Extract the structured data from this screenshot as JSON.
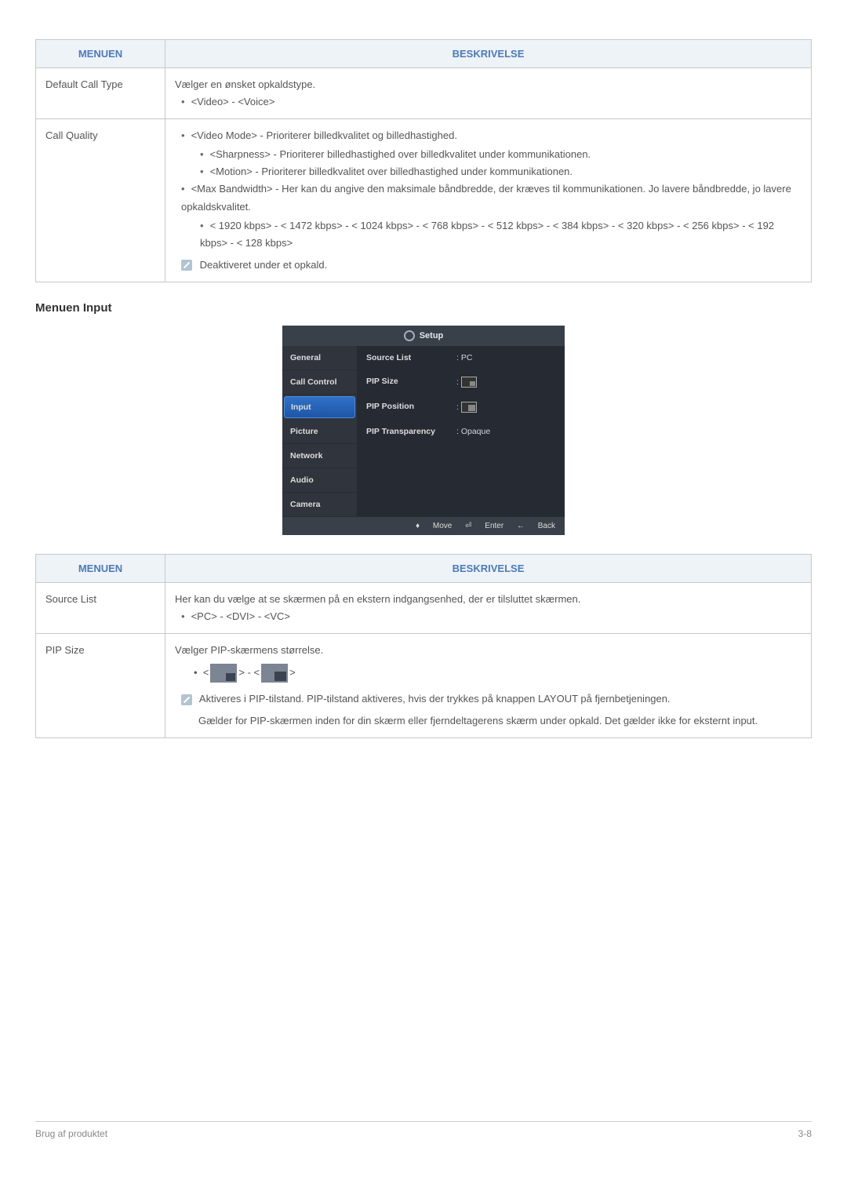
{
  "table1": {
    "th_menu": "MENUEN",
    "th_desc": "BESKRIVELSE",
    "row1": {
      "menu": "Default Call Type",
      "line1": "Vælger en ønsket opkaldstype.",
      "bullet1": "<Video> - <Voice>"
    },
    "row2": {
      "menu": "Call Quality",
      "b1": "<Video Mode> - Prioriterer billedkvalitet og billedhastighed.",
      "b1a": "<Sharpness> - Prioriterer billedhastighed over billedkvalitet under kommunikationen.",
      "b1b": "<Motion> - Prioriterer billedkvalitet over billedhastighed under kommunikationen.",
      "b2": "<Max Bandwidth> - Her kan du angive den maksimale båndbredde, der kræves til kommunikationen. Jo lavere båndbredde, jo lavere opkaldskvalitet.",
      "b2a": "< 1920 kbps> - < 1472 kbps> - < 1024 kbps> - < 768 kbps> - < 512 kbps> - < 384 kbps> - < 320 kbps> - < 256 kbps> - < 192 kbps> - < 128 kbps>",
      "note": "Deaktiveret under et opkald."
    }
  },
  "section_title": "Menuen Input",
  "osd": {
    "title": "Setup",
    "left": [
      "General",
      "Call Control",
      "Input",
      "Picture",
      "Network",
      "Audio",
      "Camera"
    ],
    "active_index": 2,
    "rows": [
      {
        "label": "Source List",
        "value": ": PC"
      },
      {
        "label": "PIP Size",
        "value_kind": "pip1"
      },
      {
        "label": "PIP Position",
        "value_kind": "pip2"
      },
      {
        "label": "PIP Transparency",
        "value": ": Opaque"
      }
    ],
    "foot": {
      "move": "Move",
      "enter": "Enter",
      "back": "Back"
    }
  },
  "table2": {
    "th_menu": "MENUEN",
    "th_desc": "BESKRIVELSE",
    "row1": {
      "menu": "Source List",
      "line1": "Her kan du vælge at se skærmen på en ekstern indgangsenhed, der er tilsluttet skærmen.",
      "bullet1": "<PC> - <DVI> - <VC>"
    },
    "row2": {
      "menu": "PIP Size",
      "line1": "Vælger PIP-skærmens størrelse.",
      "pip_prefix_a": "<",
      "pip_mid": "> - <",
      "pip_suffix": ">",
      "note1": "Aktiveres i PIP-tilstand. PIP-tilstand aktiveres, hvis der trykkes på knappen LAYOUT på fjernbetjeningen.",
      "note2": "Gælder for PIP-skærmen inden for din skærm eller fjerndeltagerens skærm under opkald. Det gælder ikke for eksternt input."
    }
  },
  "footer": {
    "left": "Brug af produktet",
    "right": "3-8"
  }
}
